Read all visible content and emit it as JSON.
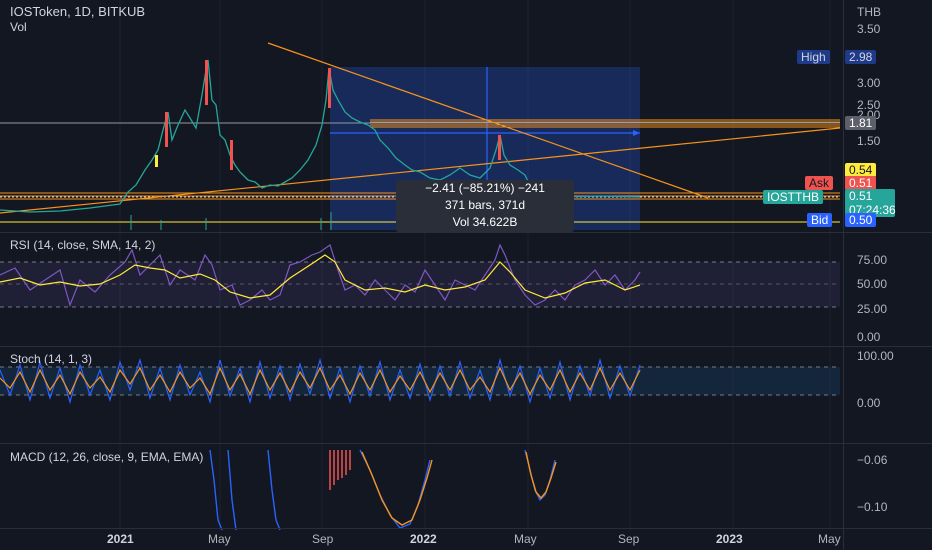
{
  "header": {
    "symbol_line": "IOSToken, 1D, BITKUB",
    "vol_label": "Vol",
    "currency": "THB"
  },
  "price_axis": {
    "ticks": [
      "3.50",
      "3.00",
      "2.50",
      "2.00",
      "1.50"
    ]
  },
  "price_tags": {
    "high_label": "High",
    "high_value": "2.98",
    "line_value": "1.81",
    "yellow_value": "0.54",
    "ask_label": "Ask",
    "ask_value": "0.51",
    "symbol_tag": "IOSTTHB",
    "last_value": "0.51",
    "countdown": "07:24:36",
    "bid_label": "Bid",
    "bid_value": "0.50"
  },
  "measure_box": {
    "line1": "−2.41 (−85.21%) −241",
    "line2": "371 bars, 371d",
    "line3": "Vol 34.622B"
  },
  "rsi": {
    "label": "RSI (14, close, SMA, 14, 2)",
    "ticks": [
      "75.00",
      "50.00",
      "25.00",
      "0.00"
    ]
  },
  "stoch": {
    "label": "Stoch (14, 1, 3)",
    "ticks": [
      "100.00",
      "0.00"
    ]
  },
  "macd": {
    "label": "MACD (12, 26, close, 9, EMA, EMA)",
    "ticks": [
      "−0.06",
      "−0.10"
    ]
  },
  "time_axis": {
    "labels": [
      "2021",
      "May",
      "Sep",
      "2022",
      "May",
      "Sep",
      "2023",
      "May"
    ]
  },
  "colors": {
    "bg": "#131722",
    "up": "#26a69a",
    "down": "#ef5350",
    "accent": "#2962ff",
    "orange": "#f7931a",
    "rsi": "#7e57c2",
    "yellow": "#ffeb3b"
  }
}
